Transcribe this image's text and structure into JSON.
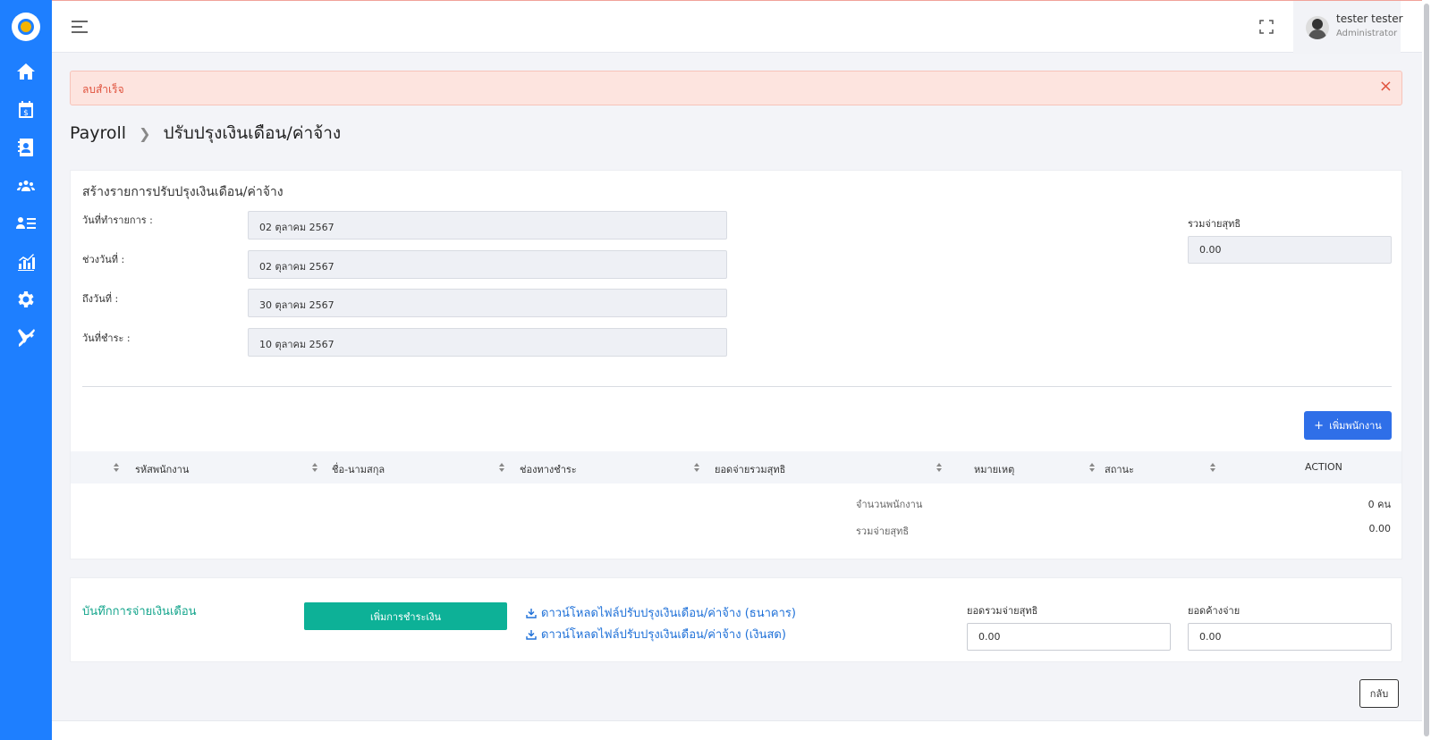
{
  "sidebar": {
    "icons": [
      "home-icon",
      "payroll-calendar-icon",
      "contact-book-icon",
      "team-gear-icon",
      "user-list-icon",
      "chart-icon",
      "settings-icon",
      "tools-icon"
    ]
  },
  "topbar": {
    "user_name": "tester tester",
    "user_role": "Administrator"
  },
  "alert": {
    "message": "ลบสำเร็จ",
    "close": "×"
  },
  "breadcrumb": {
    "root": "Payroll",
    "current": "ปรับปรุงเงินเดือน/ค่าจ้าง"
  },
  "form": {
    "title": "สร้างรายการปรับปรุงเงินเดือน/ค่าจ้าง",
    "fields": [
      {
        "label": "วันที่ทำรายการ :",
        "value": "02 ตุลาคม 2567"
      },
      {
        "label": "ช่วงวันที่ :",
        "value": "02 ตุลาคม 2567"
      },
      {
        "label": "ถึงวันที่ :",
        "value": "30 ตุลาคม 2567"
      },
      {
        "label": "วันที่ชำระ :",
        "value": "10 ตุลาคม 2567"
      }
    ],
    "net_total_label": "รวมจ่ายสุทธิ",
    "net_total_value": "0.00",
    "add_employee_button": "เพิ่มพนักงาน"
  },
  "table": {
    "columns": [
      "รหัสพนักงาน",
      "ชื่อ-นามสกุล",
      "ช่องทางชำระ",
      "ยอดจ่ายรวมสุทธิ",
      "หมายเหตุ",
      "สถานะ",
      "ACTION"
    ],
    "summary": [
      {
        "label": "จำนวนพนักงาน",
        "value": "0 คน"
      },
      {
        "label": "รวมจ่ายสุทธิ",
        "value": "0.00"
      }
    ]
  },
  "payment": {
    "title": "บันทึกการจ่ายเงินเดือน",
    "add_payment_button": "เพิ่มการชำระเงิน",
    "download_bank": "ดาวน์โหลดไฟล์ปรับปรุงเงินเดือน/ค่าจ้าง (ธนาคาร)",
    "download_cash": "ดาวน์โหลดไฟล์ปรับปรุงเงินเดือน/ค่าจ้าง (เงินสด)",
    "net_total_label": "ยอดรวมจ่ายสุทธิ",
    "net_total_value": "0.00",
    "outstanding_label": "ยอดค้างจ่าย",
    "outstanding_value": "0.00"
  },
  "back_button": "กลับ",
  "colors": {
    "sidebar": "#1e7fff",
    "primary_button": "#2f6fe8",
    "success_button": "#0db197",
    "alert_bg": "#fde4df",
    "alert_text": "#e0533e",
    "link": "#1e70d8"
  }
}
